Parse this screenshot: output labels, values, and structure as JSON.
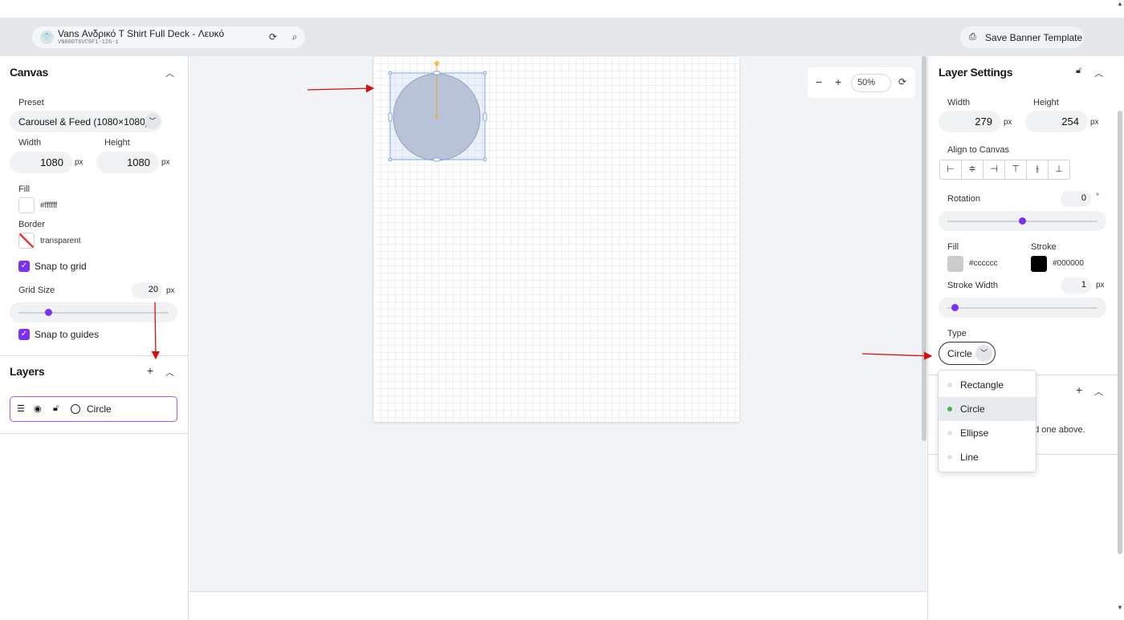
{
  "topbar": {
    "product_title": "Vans Ανδρικό T Shirt Full Deck - Λευκό",
    "product_sku": "VN000T6VC9F1-126-1",
    "save_label": "Save Banner Template"
  },
  "canvas_panel": {
    "title": "Canvas",
    "preset_label": "Preset",
    "preset_value": "Carousel & Feed (1080×1080)",
    "width_label": "Width",
    "width_value": "1080",
    "height_label": "Height",
    "height_value": "1080",
    "unit": "px",
    "fill_label": "Fill",
    "fill_value": "#ffffff",
    "border_label": "Border",
    "border_value": "transparent",
    "snap_grid_label": "Snap to grid",
    "snap_grid_checked": true,
    "grid_size_label": "Grid Size",
    "grid_size_value": "20",
    "grid_size_slider": 0.2,
    "snap_guides_label": "Snap to guides",
    "snap_guides_checked": true
  },
  "layers_panel": {
    "title": "Layers",
    "items": [
      {
        "name": "Circle"
      }
    ]
  },
  "workspace": {
    "zoom_value": "50%"
  },
  "layer_settings": {
    "title": "Layer Settings",
    "width_label": "Width",
    "width_value": "279",
    "height_label": "Height",
    "height_value": "254",
    "unit": "px",
    "align_label": "Align to Canvas",
    "rotation_label": "Rotation",
    "rotation_value": "0",
    "rotation_unit": "°",
    "rotation_slider": 0.5,
    "fill_label": "Fill",
    "fill_value": "#cccccc",
    "stroke_label": "Stroke",
    "stroke_value": "#000000",
    "stroke_width_label": "Stroke Width",
    "stroke_width_value": "1",
    "stroke_width_slider": 0.05,
    "type_label": "Type",
    "type_value": "Circle",
    "type_options": [
      "Rectangle",
      "Circle",
      "Ellipse",
      "Line"
    ],
    "hidden_hint": "dd one above."
  },
  "colors": {
    "accent": "#7b2ff7",
    "selection": "#7aa5e8",
    "shape_fill": "#cccccc",
    "annotation": "#d11111"
  }
}
